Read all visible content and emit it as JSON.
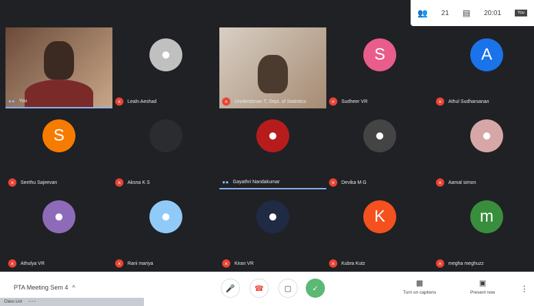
{
  "topbar": {
    "people_count": "21",
    "time": "20:01",
    "self_label": "You"
  },
  "participants": [
    {
      "name": "You",
      "type": "video",
      "muted": false,
      "speaking": true
    },
    {
      "name": "Lealn Aeshad",
      "type": "photo",
      "muted": true,
      "color": "#c0c0c0"
    },
    {
      "name": "Unnikrishnan T, Dept. of Statistics",
      "type": "video",
      "muted": true
    },
    {
      "name": "Sudheer VR",
      "type": "initial",
      "initial": "S",
      "muted": true,
      "color": "#e85d8b"
    },
    {
      "name": "Athul Sudharsanan",
      "type": "initial",
      "initial": "A",
      "muted": true,
      "color": "#1a73e8"
    },
    {
      "name": "Seethu Sajeevan",
      "type": "initial",
      "initial": "S",
      "muted": true,
      "color": "#f57c00"
    },
    {
      "name": "Aksna K S",
      "type": "photo",
      "muted": true,
      "color": "#2b2c2f"
    },
    {
      "name": "Gayathri Nandakumar",
      "type": "photo",
      "muted": false,
      "speaking": true,
      "color": "#b71c1c"
    },
    {
      "name": "Devika M G",
      "type": "photo",
      "muted": true,
      "color": "#444"
    },
    {
      "name": "Aamal simon",
      "type": "photo",
      "muted": true,
      "color": "#d7a7a7"
    },
    {
      "name": "Athulya VR",
      "type": "photo",
      "muted": true,
      "color": "#8e6bb8"
    },
    {
      "name": "Rani mariya",
      "type": "photo",
      "muted": true,
      "color": "#90caf9"
    },
    {
      "name": "Kiran VR",
      "type": "photo",
      "muted": true,
      "color": "#1f2a44"
    },
    {
      "name": "Kubra Kutz",
      "type": "initial",
      "initial": "K",
      "muted": true,
      "color": "#f4511e"
    },
    {
      "name": "megha meghuzz",
      "type": "initial",
      "initial": "m",
      "muted": true,
      "color": "#388e3c"
    }
  ],
  "bottombar": {
    "meeting_title": "PTA Meeting Sem 4",
    "chevron": "^",
    "captions_label": "Turn on captions",
    "present_label": "Present now",
    "taskbar_label": "Class List"
  }
}
